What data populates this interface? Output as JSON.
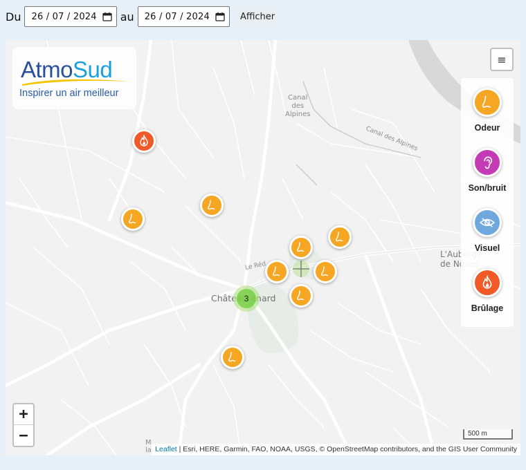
{
  "filter": {
    "from_label": "Du",
    "from_date": "26 / 07 / 2024",
    "to_label": "au",
    "to_date": "26 / 07 / 2024",
    "submit_label": "Afficher"
  },
  "logo": {
    "brand_part1": "Atmo",
    "brand_part2": "Sud",
    "tagline": "Inspirer un air meilleur",
    "colors": {
      "dark_blue": "#2a4f9b",
      "light_blue": "#1aa0db",
      "swoosh": "#f5c400"
    }
  },
  "layers_button": {
    "icon": "menu-icon",
    "glyph": "≡"
  },
  "legend": {
    "items": [
      {
        "key": "odeur",
        "label": "Odeur",
        "icon": "nose-icon",
        "color": "#f5a623"
      },
      {
        "key": "son",
        "label": "Son/bruit",
        "icon": "ear-icon",
        "color": "#c53bb5"
      },
      {
        "key": "visuel",
        "label": "Visuel",
        "icon": "eye-icon",
        "color": "#6fa8dc"
      },
      {
        "key": "brulage",
        "label": "Brûlage",
        "icon": "flame-icon",
        "color": "#f05a28"
      }
    ]
  },
  "map_labels": {
    "town": "Châteaurenard",
    "canal_vertical": [
      "Canal",
      "des",
      "Alpines"
    ],
    "canal_diagonal": "Canal des Alpines",
    "auberge": [
      "L'Auberge",
      "de Noves"
    ],
    "road": "Le Réd",
    "south": [
      "M",
      "la"
    ]
  },
  "markers": {
    "cluster_count": "3"
  },
  "zoom": {
    "in": "+",
    "out": "−"
  },
  "scale": {
    "label": "500 m"
  },
  "attribution": {
    "leaflet": "Leaflet",
    "rest": " | Esri, HERE, Garmin, FAO, NOAA, USGS, © OpenStreetMap contributors, and the GIS User Community"
  }
}
